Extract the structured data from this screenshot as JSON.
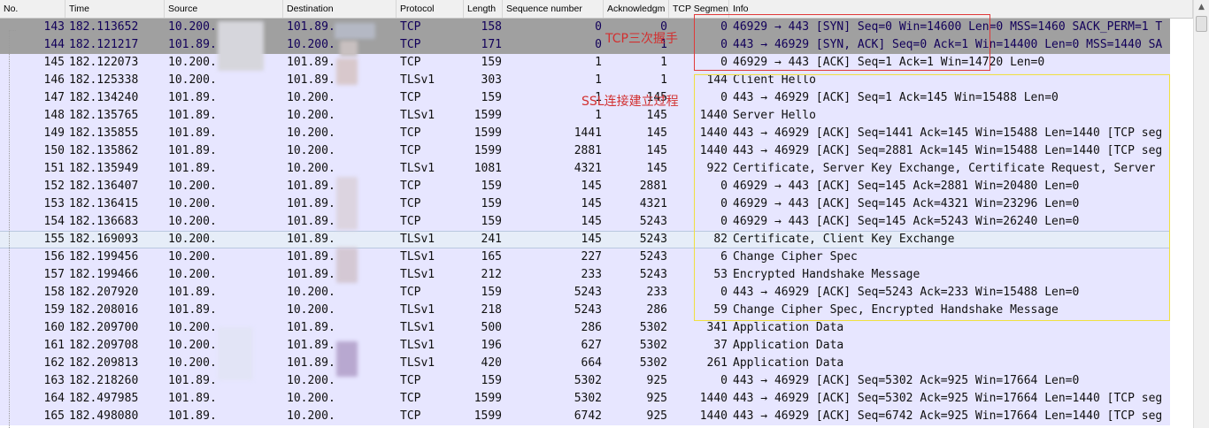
{
  "columns": {
    "no": "No.",
    "time": "Time",
    "source": "Source",
    "destination": "Destination",
    "protocol": "Protocol",
    "length": "Length",
    "seq": "Sequence number",
    "ack": "Acknowledgm",
    "tcpseg": "TCP Segmen",
    "info": "Info"
  },
  "annotations": {
    "tcp_handshake": "TCP三次握手",
    "ssl_setup": "SSL连接建立过程"
  },
  "colors": {
    "row_bg": "#e7e6ff",
    "selected_bg": "#a0a0a0",
    "tcp_box": "#e03a3a",
    "ssl_box": "#f0e040"
  },
  "packets": [
    {
      "no": "143",
      "time": "182.113652",
      "src": "10.200.",
      "dst": "101.89.",
      "proto": "TCP",
      "len": "158",
      "seq": "0",
      "ack": "0",
      "tcpseg": "0",
      "info": "46929 → 443 [SYN] Seq=0 Win=14600 Len=0 MSS=1460 SACK_PERM=1 T"
    },
    {
      "no": "144",
      "time": "182.121217",
      "src": "101.89.",
      "dst": "10.200.",
      "proto": "TCP",
      "len": "171",
      "seq": "0",
      "ack": "1",
      "tcpseg": "0",
      "info": "443 → 46929 [SYN, ACK] Seq=0 Ack=1 Win=14400 Len=0 MSS=1440 SA"
    },
    {
      "no": "145",
      "time": "182.122073",
      "src": "10.200.",
      "dst": "101.89.",
      "proto": "TCP",
      "len": "159",
      "seq": "1",
      "ack": "1",
      "tcpseg": "0",
      "info": "46929 → 443 [ACK] Seq=1 Ack=1 Win=14720 Len=0"
    },
    {
      "no": "146",
      "time": "182.125338",
      "src": "10.200.",
      "dst": "101.89.",
      "proto": "TLSv1",
      "len": "303",
      "seq": "1",
      "ack": "1",
      "tcpseg": "144",
      "info": "Client Hello"
    },
    {
      "no": "147",
      "time": "182.134240",
      "src": "101.89.",
      "dst": "10.200.",
      "proto": "TCP",
      "len": "159",
      "seq": "1",
      "ack": "145",
      "tcpseg": "0",
      "info": "443 → 46929 [ACK] Seq=1 Ack=145 Win=15488 Len=0"
    },
    {
      "no": "148",
      "time": "182.135765",
      "src": "101.89.",
      "dst": "10.200.",
      "proto": "TLSv1",
      "len": "1599",
      "seq": "1",
      "ack": "145",
      "tcpseg": "1440",
      "info": "Server Hello"
    },
    {
      "no": "149",
      "time": "182.135855",
      "src": "101.89.",
      "dst": "10.200.",
      "proto": "TCP",
      "len": "1599",
      "seq": "1441",
      "ack": "145",
      "tcpseg": "1440",
      "info": "443 → 46929 [ACK] Seq=1441 Ack=145 Win=15488 Len=1440 [TCP seg"
    },
    {
      "no": "150",
      "time": "182.135862",
      "src": "101.89.",
      "dst": "10.200.",
      "proto": "TCP",
      "len": "1599",
      "seq": "2881",
      "ack": "145",
      "tcpseg": "1440",
      "info": "443 → 46929 [ACK] Seq=2881 Ack=145 Win=15488 Len=1440 [TCP seg"
    },
    {
      "no": "151",
      "time": "182.135949",
      "src": "101.89.",
      "dst": "10.200.",
      "proto": "TLSv1",
      "len": "1081",
      "seq": "4321",
      "ack": "145",
      "tcpseg": "922",
      "info": "Certificate, Server Key Exchange, Certificate Request, Server"
    },
    {
      "no": "152",
      "time": "182.136407",
      "src": "10.200.",
      "dst": "101.89.",
      "proto": "TCP",
      "len": "159",
      "seq": "145",
      "ack": "2881",
      "tcpseg": "0",
      "info": "46929 → 443 [ACK] Seq=145 Ack=2881 Win=20480 Len=0"
    },
    {
      "no": "153",
      "time": "182.136415",
      "src": "10.200.",
      "dst": "101.89.",
      "proto": "TCP",
      "len": "159",
      "seq": "145",
      "ack": "4321",
      "tcpseg": "0",
      "info": "46929 → 443 [ACK] Seq=145 Ack=4321 Win=23296 Len=0"
    },
    {
      "no": "154",
      "time": "182.136683",
      "src": "10.200.",
      "dst": "101.89.",
      "proto": "TCP",
      "len": "159",
      "seq": "145",
      "ack": "5243",
      "tcpseg": "0",
      "info": "46929 → 443 [ACK] Seq=145 Ack=5243 Win=26240 Len=0"
    },
    {
      "no": "155",
      "time": "182.169093",
      "src": "10.200.",
      "dst": "101.89.",
      "proto": "TLSv1",
      "len": "241",
      "seq": "145",
      "ack": "5243",
      "tcpseg": "82",
      "info": "Certificate, Client Key Exchange"
    },
    {
      "no": "156",
      "time": "182.199456",
      "src": "10.200.",
      "dst": "101.89.",
      "proto": "TLSv1",
      "len": "165",
      "seq": "227",
      "ack": "5243",
      "tcpseg": "6",
      "info": "Change Cipher Spec"
    },
    {
      "no": "157",
      "time": "182.199466",
      "src": "10.200.",
      "dst": "101.89.",
      "proto": "TLSv1",
      "len": "212",
      "seq": "233",
      "ack": "5243",
      "tcpseg": "53",
      "info": "Encrypted Handshake Message"
    },
    {
      "no": "158",
      "time": "182.207920",
      "src": "101.89.",
      "dst": "10.200.",
      "proto": "TCP",
      "len": "159",
      "seq": "5243",
      "ack": "233",
      "tcpseg": "0",
      "info": "443 → 46929 [ACK] Seq=5243 Ack=233 Win=15488 Len=0"
    },
    {
      "no": "159",
      "time": "182.208016",
      "src": "101.89.",
      "dst": "10.200.",
      "proto": "TLSv1",
      "len": "218",
      "seq": "5243",
      "ack": "286",
      "tcpseg": "59",
      "info": "Change Cipher Spec, Encrypted Handshake Message"
    },
    {
      "no": "160",
      "time": "182.209700",
      "src": "10.200.",
      "dst": "101.89.",
      "proto": "TLSv1",
      "len": "500",
      "seq": "286",
      "ack": "5302",
      "tcpseg": "341",
      "info": "Application Data"
    },
    {
      "no": "161",
      "time": "182.209708",
      "src": "10.200.",
      "dst": "101.89.",
      "proto": "TLSv1",
      "len": "196",
      "seq": "627",
      "ack": "5302",
      "tcpseg": "37",
      "info": "Application Data"
    },
    {
      "no": "162",
      "time": "182.209813",
      "src": "10.200.",
      "dst": "101.89.",
      "proto": "TLSv1",
      "len": "420",
      "seq": "664",
      "ack": "5302",
      "tcpseg": "261",
      "info": "Application Data"
    },
    {
      "no": "163",
      "time": "182.218260",
      "src": "101.89.",
      "dst": "10.200.",
      "proto": "TCP",
      "len": "159",
      "seq": "5302",
      "ack": "925",
      "tcpseg": "0",
      "info": "443 → 46929 [ACK] Seq=5302 Ack=925 Win=17664 Len=0"
    },
    {
      "no": "164",
      "time": "182.497985",
      "src": "101.89.",
      "dst": "10.200.",
      "proto": "TCP",
      "len": "1599",
      "seq": "5302",
      "ack": "925",
      "tcpseg": "1440",
      "info": "443 → 46929 [ACK] Seq=5302 Ack=925 Win=17664 Len=1440 [TCP seg"
    },
    {
      "no": "165",
      "time": "182.498080",
      "src": "101.89.",
      "dst": "10.200.",
      "proto": "TCP",
      "len": "1599",
      "seq": "6742",
      "ack": "925",
      "tcpseg": "1440",
      "info": "443 → 46929 [ACK] Seq=6742 Ack=925 Win=17664 Len=1440 [TCP seg"
    }
  ]
}
